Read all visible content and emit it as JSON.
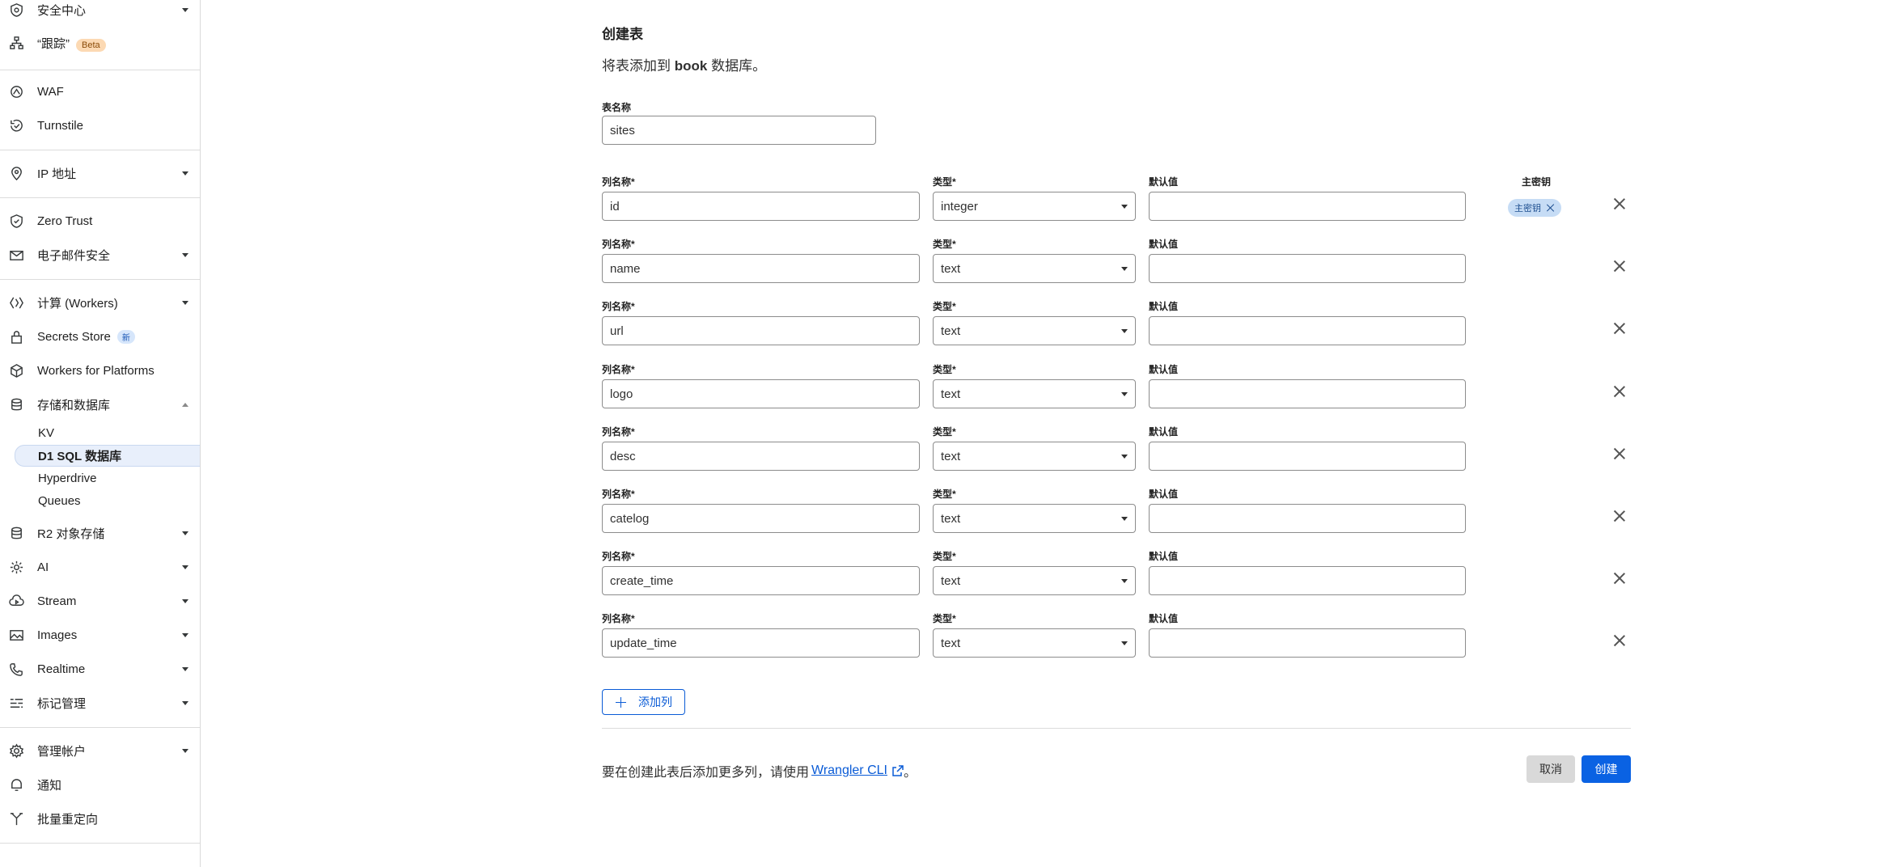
{
  "sidebar": {
    "items": [
      {
        "id": "security",
        "label": "安全中心",
        "icon": "shield-target-icon"
      },
      {
        "id": "trace",
        "label": "“跟踪”",
        "icon": "sitemap-icon",
        "badge": "Beta"
      },
      {
        "id": "waf",
        "label": "WAF",
        "icon": "waf-icon"
      },
      {
        "id": "turnstile",
        "label": "Turnstile",
        "icon": "turnstile-icon"
      },
      {
        "id": "ip",
        "label": "IP 地址",
        "icon": "location-pin-icon"
      },
      {
        "id": "zerotrust",
        "label": "Zero Trust",
        "icon": "zero-trust-icon"
      },
      {
        "id": "email",
        "label": "电子邮件安全",
        "icon": "envelope-icon"
      },
      {
        "id": "workers",
        "label": "计算 (Workers)",
        "icon": "workers-icon"
      },
      {
        "id": "secrets",
        "label": "Secrets Store",
        "icon": "lock-icon",
        "badge": "新"
      },
      {
        "id": "platforms",
        "label": "Workers for Platforms",
        "icon": "cube-icon"
      },
      {
        "id": "storage",
        "label": "存储和数据库",
        "icon": "database-icon"
      },
      {
        "id": "r2",
        "label": "R2 对象存储",
        "icon": "storage-icon"
      },
      {
        "id": "ai",
        "label": "AI",
        "icon": "ai-icon"
      },
      {
        "id": "stream",
        "label": "Stream",
        "icon": "cloud-play-icon"
      },
      {
        "id": "images",
        "label": "Images",
        "icon": "image-icon"
      },
      {
        "id": "realtime",
        "label": "Realtime",
        "icon": "phone-icon"
      },
      {
        "id": "tags",
        "label": "标记管理",
        "icon": "tag-manager-icon"
      },
      {
        "id": "account",
        "label": "管理帐户",
        "icon": "gear-icon"
      },
      {
        "id": "notify",
        "label": "通知",
        "icon": "notification-icon"
      },
      {
        "id": "redirect",
        "label": "批量重定向",
        "icon": "redirect-icon"
      }
    ],
    "storage_subitems": [
      "KV",
      "D1 SQL 数据库",
      "Hyperdrive",
      "Queues"
    ]
  },
  "form": {
    "title": "创建表",
    "subtitle_prefix": "将表添加到",
    "db_name": "book",
    "subtitle_suffix": "数据库。",
    "table_name_label": "表名称",
    "table_name_value": "sites",
    "col_name_label": "列名称*",
    "type_label": "类型*",
    "default_label": "默认值",
    "pk_label": "主密钥",
    "pk_chip": "主密钥",
    "columns": [
      {
        "name": "id",
        "type": "integer",
        "default": ""
      },
      {
        "name": "name",
        "type": "text",
        "default": ""
      },
      {
        "name": "url",
        "type": "text",
        "default": ""
      },
      {
        "name": "logo",
        "type": "text",
        "default": ""
      },
      {
        "name": "desc",
        "type": "text",
        "default": ""
      },
      {
        "name": "catelog",
        "type": "text",
        "default": ""
      },
      {
        "name": "create_time",
        "type": "text",
        "default": ""
      },
      {
        "name": "update_time",
        "type": "text",
        "default": ""
      }
    ],
    "add_column": "添加列",
    "footer_prefix": "要在创建此表后添加更多列，请使用",
    "footer_link": "Wrangler CLI",
    "footer_suffix": "。",
    "cancel": "取消",
    "create": "创建"
  }
}
